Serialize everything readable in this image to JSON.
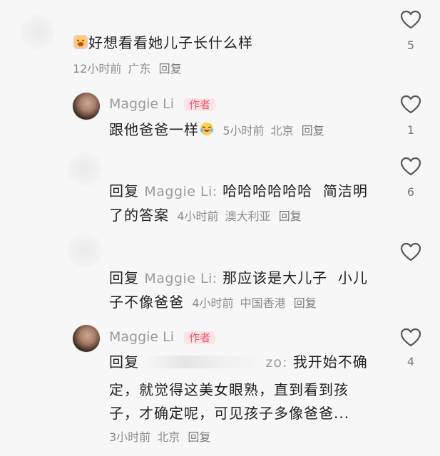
{
  "comments": [
    {
      "text": "好想看看她儿子长什么样",
      "meta_time": "12小时前",
      "meta_location": "广东",
      "meta_reply": "回复",
      "likes": "5",
      "emoji": "crying-face"
    },
    {
      "author": "Maggie Li",
      "badge": "作者",
      "text": "跟他爸爸一样",
      "meta_time": "5小时前",
      "meta_location": "北京",
      "meta_reply": "回复",
      "likes": "1",
      "emoji": "laughing-crying-face"
    },
    {
      "reply_prefix": "回复",
      "reply_to": "Maggie Li:",
      "text_line1": "哈哈哈哈哈哈  简洁明",
      "text_line2": "了的答案",
      "meta_time": "4小时前",
      "meta_location": "澳大利亚",
      "meta_reply": "回复",
      "likes": "6"
    },
    {
      "reply_prefix": "回复",
      "reply_to": "Maggie Li:",
      "text_line1": "那应该是大儿子  小儿",
      "text_line2": "子不像爸爸",
      "meta_time": "4小时前",
      "meta_location": "中国香港",
      "meta_reply": "回复",
      "likes": ""
    },
    {
      "author": "Maggie Li",
      "badge": "作者",
      "reply_prefix": "回复",
      "reply_to_tail": "zo:",
      "text_line1_tail": "我开始不确",
      "text_line2": "定，就觉得这美女眼熟，直到看到孩",
      "text_line3": "子，才确定呢，可见孩子多像爸爸...",
      "meta_time": "3小时前",
      "meta_location": "北京",
      "meta_reply": "回复",
      "likes": "4"
    }
  ],
  "colors": {
    "background": "#f7f7f7",
    "author_badge_text": "#e85a6b",
    "author_badge_bg": "#fbe3e6",
    "meta_gray": "#8c8c8c"
  }
}
